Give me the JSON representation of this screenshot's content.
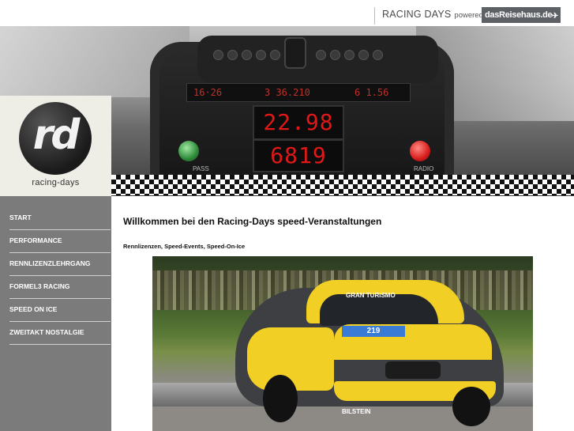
{
  "header": {
    "brand_name": "RACING DAYS",
    "powered_by": "powered by",
    "partner_logo": "dasReisehaus.de"
  },
  "hero": {
    "strip_left": "16·26",
    "strip_mid": "3 36.210",
    "strip_right": "6 1.56",
    "display_top": "22.98",
    "display_bottom": "6819",
    "label_pass": "PASS",
    "label_radio": "RADIO"
  },
  "logo": {
    "mark": "rd",
    "text": "racing-days"
  },
  "sidebar": {
    "items": [
      {
        "label": "START"
      },
      {
        "label": "PERFORMANCE"
      },
      {
        "label": "RENNLIZENZLEHRGANG"
      },
      {
        "label": "FORMEL3 RACING"
      },
      {
        "label": "SPEED ON ICE"
      },
      {
        "label": "ZWEITAKT NOSTALGIE"
      }
    ]
  },
  "main": {
    "title": "Willkommen bei den Racing-Days speed-Veranstaltungen",
    "subtitle": "Rennlizenzen, Speed-Events, Speed-On-Ice"
  },
  "photo": {
    "banner_text": "GRAN TURISMO",
    "race_number": "219",
    "sponsor": "BILSTEIN"
  }
}
